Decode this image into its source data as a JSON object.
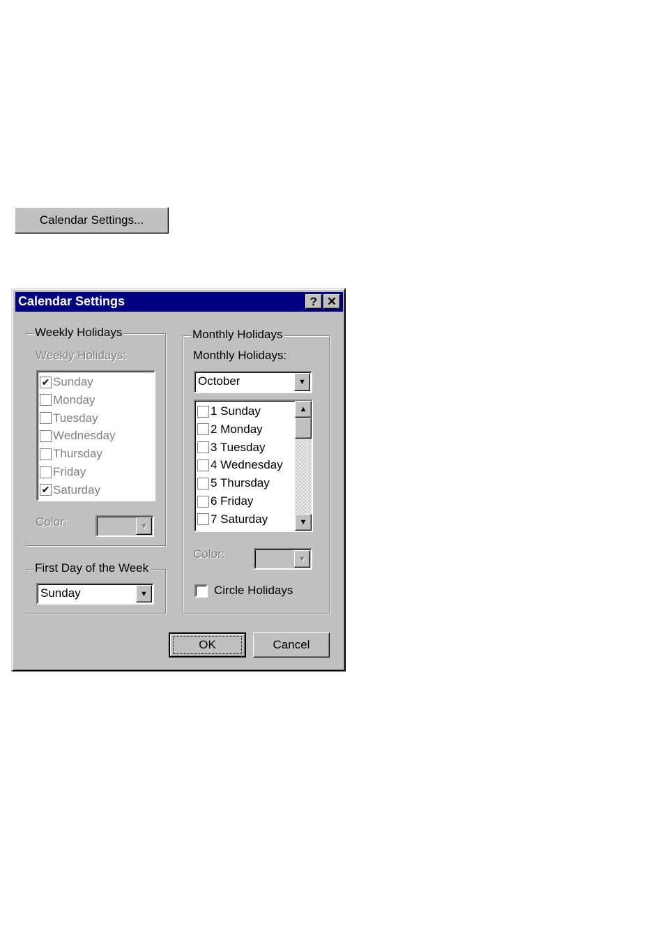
{
  "launcher_button": "Calendar Settings...",
  "dialog": {
    "title": "Calendar Settings",
    "help_glyph": "?",
    "close_glyph": "✕",
    "weekly": {
      "group_label": "Weekly Holidays",
      "list_label": "Weekly Holidays:",
      "items": [
        {
          "label": "Sunday",
          "checked": true
        },
        {
          "label": "Monday",
          "checked": false
        },
        {
          "label": "Tuesday",
          "checked": false
        },
        {
          "label": "Wednesday",
          "checked": false
        },
        {
          "label": "Thursday",
          "checked": false
        },
        {
          "label": "Friday",
          "checked": false
        },
        {
          "label": "Saturday",
          "checked": true
        }
      ],
      "color_label": "Color:"
    },
    "first_day": {
      "group_label": "First Day of the Week",
      "value": "Sunday"
    },
    "monthly": {
      "group_label": "Monthly Holidays",
      "list_label": "Monthly Holidays:",
      "month": "October",
      "items": [
        {
          "label": "1 Sunday",
          "checked": false
        },
        {
          "label": "2 Monday",
          "checked": false
        },
        {
          "label": "3 Tuesday",
          "checked": false
        },
        {
          "label": "4 Wednesday",
          "checked": false
        },
        {
          "label": "5 Thursday",
          "checked": false
        },
        {
          "label": "6 Friday",
          "checked": false
        },
        {
          "label": "7 Saturday",
          "checked": false
        }
      ],
      "color_label": "Color:",
      "circle_holidays_label": "Circle Holidays",
      "circle_holidays_checked": false
    },
    "ok_label": "OK",
    "cancel_label": "Cancel",
    "colors": {
      "titlebar": "#000080",
      "face": "#c0c0c0"
    }
  }
}
